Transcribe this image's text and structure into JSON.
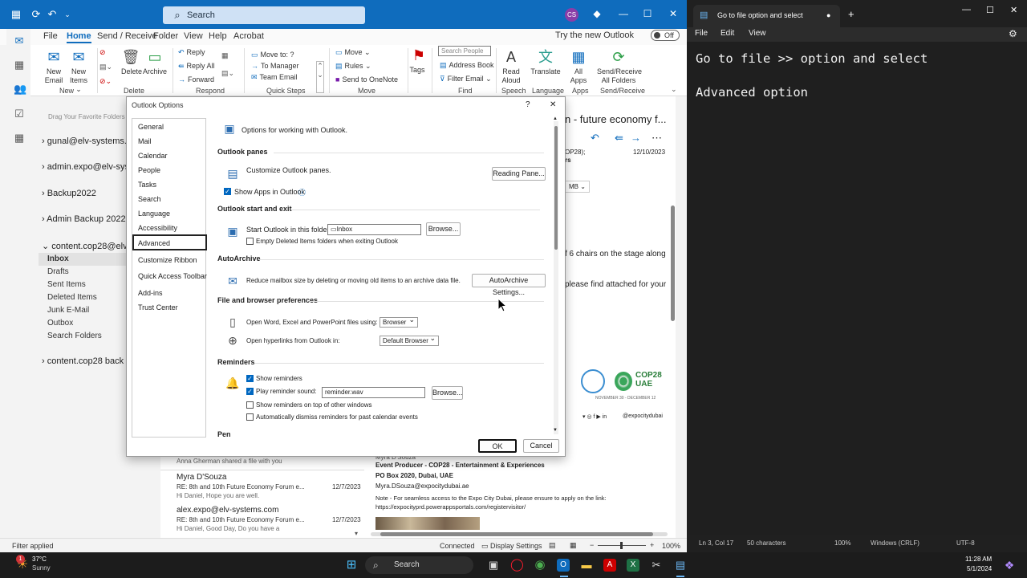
{
  "outlook": {
    "search_placeholder": "Search",
    "avatar": "CS",
    "menu": [
      "File",
      "Home",
      "Send / Receive",
      "Folder",
      "View",
      "Help",
      "Acrobat"
    ],
    "try_new": "Try the new Outlook",
    "toggle": "Off",
    "ribbon": {
      "new_email": "New\nEmail",
      "new_items": "New\nItems ⌄",
      "delete": "Delete",
      "archive": "Archive",
      "reply": "Reply",
      "reply_all": "Reply All",
      "forward": "Forward",
      "move_to": "Move to: ?",
      "to_manager": "To Manager",
      "team_email": "Team Email",
      "move": "Move ⌄",
      "rules": "Rules ⌄",
      "send_onenote": "Send to OneNote",
      "tags": "Tags",
      "search_people": "Search People",
      "address_book": "Address Book",
      "filter_email": "Filter Email ⌄",
      "read_aloud": "Read\nAloud",
      "translate": "Translate",
      "all_apps": "All\nApps",
      "send_receive_all": "Send/Receive\nAll Folders",
      "groups": [
        "New",
        "Delete",
        "Respond",
        "Quick Steps",
        "Move",
        "Find",
        "Speech",
        "Language",
        "Apps",
        "Send/Receive"
      ]
    },
    "folders": {
      "drag_hint": "Drag Your Favorite Folders H",
      "accounts": [
        "gunal@elv-systems.co",
        "admin.expo@elv-syste",
        "Backup2022",
        "Admin Backup 2022",
        "content.cop28@elv-sy",
        "content.cop28 back up"
      ],
      "items": [
        "Inbox",
        "Drafts",
        "Sent Items",
        "Deleted Items",
        "Junk E-Mail",
        "Outbox",
        "Search Folders"
      ]
    },
    "reading": {
      "subject": "n - future economy f...",
      "meta1": "OP28);",
      "meta2": "rs",
      "date": "12/10/2023",
      "size": "MB",
      "body1": "f 6 chairs on the stage along",
      "body2": "please find attached for your",
      "social": "@expocitydubai",
      "sig_name": "Myra D'Souza",
      "sig_title": "Event Producer - COP28 - Entertainment & Experiences",
      "sig_box": "PO Box 2020, Dubai, UAE",
      "sig_email": "Myra.DSouza@expocitydubai.ae",
      "note": "Note - For seamless access to the Expo City Dubai, please ensure to apply on the link:",
      "link": "https://expocityprd.powerappsportals.com/registervisitor/",
      "cop_logo": "COP28\nUAE",
      "cop_dates": "NOVEMBER 30 - DECEMBER 12"
    },
    "messages": [
      {
        "from": "Anna Gherman shared a file with you",
        "subject": "",
        "date": "",
        "preview": ""
      },
      {
        "from": "Myra D'Souza",
        "subject": "RE: 8th and 10th Future Economy Forum e...",
        "date": "12/7/2023",
        "preview": "Hi Daniel,   Hope you are well."
      },
      {
        "from": "alex.expo@elv-systems.com",
        "subject": "RE: 8th and 10th Future Economy Forum e...",
        "date": "12/7/2023",
        "preview": "Hi Daniel,  Good Day,  Do you have a"
      }
    ],
    "status": {
      "left": "Filter applied",
      "connected": "Connected",
      "display": "Display Settings",
      "zoom": "100%"
    }
  },
  "dialog": {
    "title": "Outlook Options",
    "help": "?",
    "close": "✕",
    "nav": [
      "General",
      "Mail",
      "Calendar",
      "People",
      "Tasks",
      "Search",
      "Language",
      "Accessibility",
      "Advanced",
      "Customize Ribbon",
      "Quick Access Toolbar",
      "Add-ins",
      "Trust Center"
    ],
    "header": "Options for working with Outlook.",
    "sections": {
      "panes": "Outlook panes",
      "start": "Outlook start and exit",
      "autoarchive": "AutoArchive",
      "file": "File and browser preferences",
      "reminders": "Reminders",
      "pen": "Pen"
    },
    "customize_panes": "Customize Outlook panes.",
    "reading_pane_btn": "Reading Pane...",
    "show_apps": "Show Apps in Outlook",
    "start_folder_label": "Start Outlook in this folder:",
    "start_folder_value": "Inbox",
    "browse": "Browse...",
    "empty_deleted": "Empty Deleted Items folders when exiting Outlook",
    "reduce_mailbox": "Reduce mailbox size by deleting or moving old items to an archive data file.",
    "autoarchive_btn": "AutoArchive Settings...",
    "open_files_label": "Open Word, Excel and PowerPoint files using:",
    "open_files_value": "Browser",
    "hyperlinks_label": "Open hyperlinks from Outlook in:",
    "hyperlinks_value": "Default Browser",
    "show_reminders": "Show reminders",
    "play_sound": "Play reminder sound:",
    "sound_value": "reminder.wav",
    "reminders_top": "Show reminders on top of other windows",
    "auto_dismiss": "Automatically dismiss reminders for past calendar events",
    "ok": "OK",
    "cancel": "Cancel"
  },
  "notepad": {
    "tab_title": "Go to file  option and select",
    "menu": [
      "File",
      "Edit",
      "View"
    ],
    "content": "Go to file >> option and select\n\nAdvanced option",
    "status": {
      "pos": "Ln 3, Col 17",
      "chars": "50 characters",
      "zoom": "100%",
      "eol": "Windows (CRLF)",
      "enc": "UTF-8"
    }
  },
  "taskbar": {
    "temp": "37°C",
    "weather": "Sunny",
    "search": "Search",
    "time": "11:28 AM",
    "date": "5/1/2024",
    "badge": "1"
  }
}
